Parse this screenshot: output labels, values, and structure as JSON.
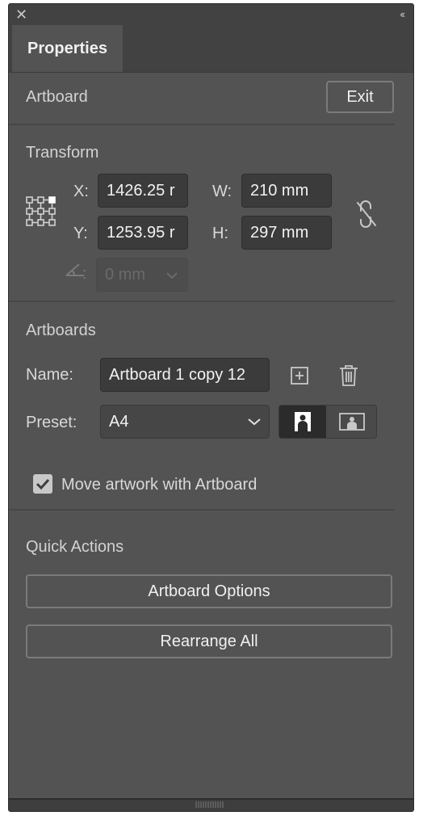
{
  "window": {
    "close_glyph": "✕",
    "collapse_glyph": "‹‹"
  },
  "tabs": [
    {
      "label": "Properties",
      "active": true
    }
  ],
  "artboard_header": {
    "title": "Artboard",
    "exit_label": "Exit"
  },
  "transform": {
    "title": "Transform",
    "x_label": "X:",
    "x_value": "1426.25 r",
    "y_label": "Y:",
    "y_value": "1253.95 r",
    "w_label": "W:",
    "w_value": "210 mm",
    "h_label": "H:",
    "h_value": "297 mm",
    "rotate_suffix": ":",
    "rotate_value": "0 mm",
    "reference_point_icon": "reference-point-grid",
    "constrain_icon": "unlinked-chain"
  },
  "artboards": {
    "title": "Artboards",
    "name_label": "Name:",
    "name_value": "Artboard 1 copy 12",
    "preset_label": "Preset:",
    "preset_value": "A4",
    "orientation": "portrait",
    "move_artwork_label": "Move artwork with Artboard",
    "move_artwork_checked": true
  },
  "quick_actions": {
    "title": "Quick Actions",
    "artboard_options_label": "Artboard Options",
    "rearrange_all_label": "Rearrange All"
  },
  "colors": {
    "panel_bg": "#535353",
    "tab_bar_bg": "#424242",
    "field_bg": "#3b3b3b",
    "text": "#d8d8d8"
  }
}
